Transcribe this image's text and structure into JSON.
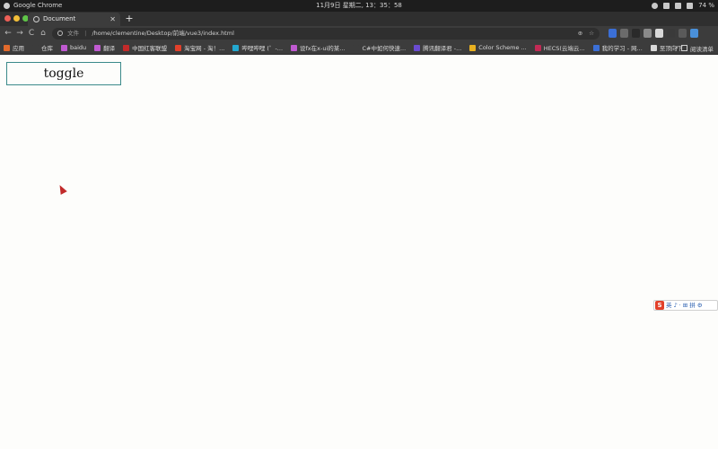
{
  "os_bar": {
    "app_name": "Google Chrome",
    "clock": "11月9日 星期二, 13：35：58",
    "battery": "74 %"
  },
  "browser": {
    "tab_title": "Document",
    "tab_close": "✕",
    "new_tab": "+",
    "nav": {
      "back": "←",
      "forward": "→",
      "reload": "C",
      "home": "⌂"
    },
    "address_scheme": "文件",
    "address_sep": "|",
    "address_url": "/home/clementine/Desktop/前端/vue3/index.html",
    "extension_colors": [
      "#3b6fd6",
      "#6b6b6b",
      "#2a2a2a",
      "#8a8a8a",
      "#d8d8d8",
      "#3a3a3a",
      "#5a5a5a",
      "#4a90d9"
    ]
  },
  "bookmarks": {
    "items": [
      {
        "label": "应用",
        "icon_color": "#e26a2c"
      },
      {
        "label": "仓库",
        "icon_color": "#3c3c3c"
      },
      {
        "label": "baidu",
        "icon_color": "#c05ad1"
      },
      {
        "label": "翻译",
        "icon_color": "#c05ad1"
      },
      {
        "label": "中国红客联盟",
        "icon_color": "#c22a2a"
      },
      {
        "label": "淘宝网 - 淘！...",
        "icon_color": "#e2402a"
      },
      {
        "label": "哔哩哔哩 (゜-...",
        "icon_color": "#23a8cf"
      },
      {
        "label": "设fx在x-ui的某...",
        "icon_color": "#c05ad1"
      },
      {
        "label": "C#中如何快速...",
        "icon_color": "#3c3c3c"
      },
      {
        "label": "腾讯翻译君 -...",
        "icon_color": "#6a4bd1"
      },
      {
        "label": "Color Scheme ...",
        "icon_color": "#e8b020"
      },
      {
        "label": "HECS(云端云...",
        "icon_color": "#c22a55"
      },
      {
        "label": "我的学习 - 网...",
        "icon_color": "#3b6fd6"
      },
      {
        "label": "至顶向下",
        "icon_color": "#d8d8d8"
      }
    ],
    "more": "»",
    "reading_list": "阅读清单"
  },
  "page": {
    "toggle_label": "toggle"
  },
  "ime": {
    "logo": "S",
    "items": [
      "英",
      "♪",
      "·",
      "⊞",
      "拼",
      "⚙"
    ]
  }
}
